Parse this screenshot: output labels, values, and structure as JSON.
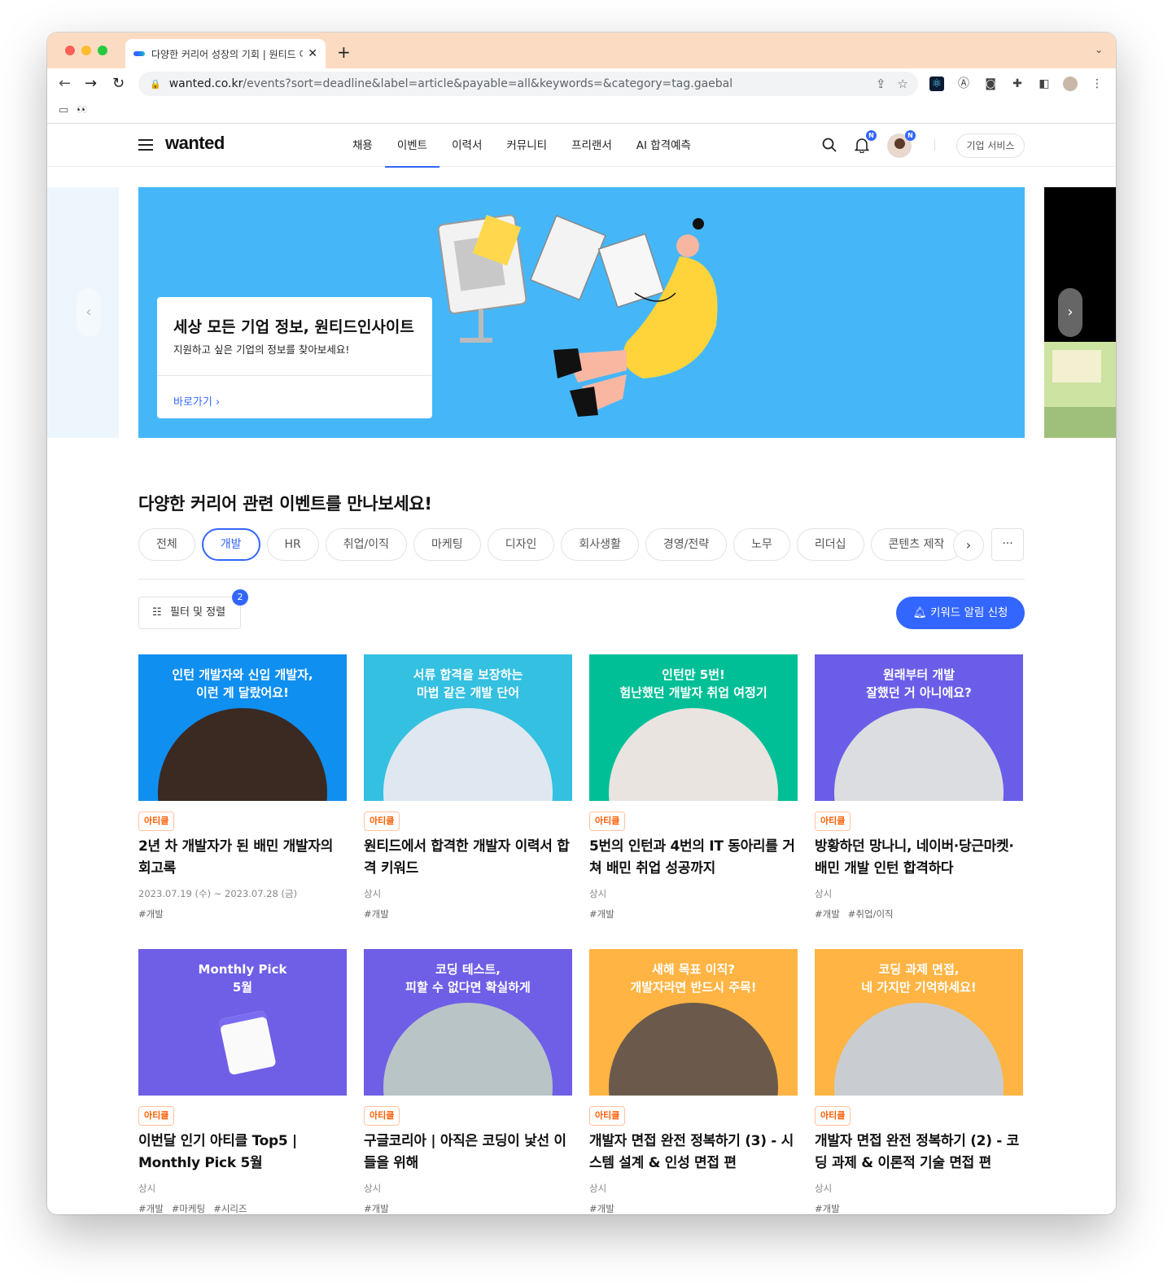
{
  "browser": {
    "tab_title": "다양한 커리어 성장의 기회 | 원티드 이벤트",
    "url_host": "wanted.co.kr",
    "url_path": "/events?sort=deadline&label=article&payable=all&keywords=&category=tag.gaebal"
  },
  "header": {
    "logo": "wanted",
    "menu": [
      "채용",
      "이벤트",
      "이력서",
      "커뮤니티",
      "프리랜서",
      "AI 합격예측"
    ],
    "badge": "N",
    "corp_button": "기업 서비스"
  },
  "hero": {
    "title": "세상 모든 기업 정보, 원티드인사이트",
    "subtitle": "지원하고 싶은 기업의 정보를 찾아보세요!",
    "link": "바로가기"
  },
  "section_title": "다양한 커리어 관련 이벤트를 만나보세요!",
  "categories": [
    "전체",
    "개발",
    "HR",
    "취업/이직",
    "마케팅",
    "디자인",
    "회사생활",
    "경영/전략",
    "노무",
    "리더십",
    "콘텐츠 제작"
  ],
  "active_category": "개발",
  "filter": {
    "label": "필터 및 정렬",
    "count": "2"
  },
  "keyword_alert": "키워드 알림 신청",
  "cards": [
    {
      "tag": "아티클",
      "caption": "인턴 개발자와 신입 개발자,\n이런 게 달랐어요!",
      "bg": "#0f8ff0",
      "title": "2년 차 개발자가 된 배민 개발자의 회고록",
      "date": "2023.07.19 (수) ~ 2023.07.28 (금)",
      "keywords": [
        "#개발"
      ]
    },
    {
      "tag": "아티클",
      "caption": "서류 합격을 보장하는\n마법 같은 개발 단어",
      "bg": "#34c0e0",
      "title": "원티드에서 합격한 개발자 이력서 합격 키워드",
      "date": "상시",
      "keywords": [
        "#개발"
      ]
    },
    {
      "tag": "아티클",
      "caption": "인턴만 5번!\n험난했던 개발자 취업 여정기",
      "bg": "#00bf96",
      "title": "5번의 인턴과 4번의 IT 동아리를 거쳐 배민 취업 성공까지",
      "date": "상시",
      "keywords": [
        "#개발"
      ]
    },
    {
      "tag": "아티클",
      "caption": "원래부터 개발\n잘했던 거 아니에요?",
      "bg": "#6a5ee8",
      "title": "방황하던 망나니, 네이버·당근마켓·배민 개발 인턴 합격하다",
      "date": "상시",
      "keywords": [
        "#개발",
        "#취업/이직"
      ]
    },
    {
      "tag": "아티클",
      "caption": "Monthly Pick\n5월",
      "bg": "#6f5ee6",
      "title": "이번달 인기 아티클 Top5 | Monthly Pick 5월",
      "date": "상시",
      "keywords": [
        "#개발",
        "#마케팅",
        "#시리즈"
      ]
    },
    {
      "tag": "아티클",
      "caption": "코딩 테스트,\n피할 수 없다면 확실하게",
      "bg": "#6f5ee6",
      "title": "구글코리아 | 아직은 코딩이 낯선 이들을 위해",
      "date": "상시",
      "keywords": [
        "#개발"
      ]
    },
    {
      "tag": "아티클",
      "caption": "새해 목표 이직?\n개발자라면 반드시 주목!",
      "bg": "#ffb443",
      "title": "개발자 면접 완전 정복하기 (3) - 시스템 설계 & 인성 면접 편",
      "date": "상시",
      "keywords": [
        "#개발"
      ]
    },
    {
      "tag": "아티클",
      "caption": "코딩 과제 면접,\n네 가지만 기억하세요!",
      "bg": "#ffb443",
      "title": "개발자 면접 완전 정복하기 (2) - 코딩 과제 & 이론적 기술 면접 편",
      "date": "상시",
      "keywords": [
        "#개발"
      ]
    }
  ]
}
